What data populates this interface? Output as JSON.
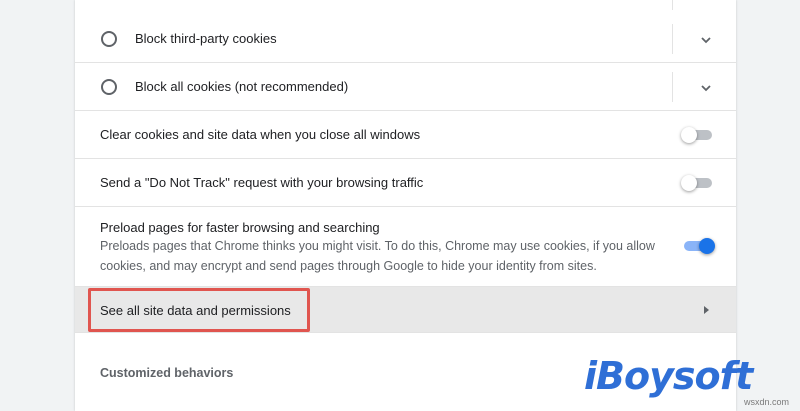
{
  "cookie_options": [
    {
      "label": "Block third-party cookies"
    },
    {
      "label": "Block all cookies (not recommended)"
    }
  ],
  "toggles": {
    "clear_on_close": {
      "label": "Clear cookies and site data when you close all windows",
      "state": "off"
    },
    "do_not_track": {
      "label": "Send a \"Do Not Track\" request with your browsing traffic",
      "state": "off"
    },
    "preload": {
      "label": "Preload pages for faster browsing and searching",
      "description": "Preloads pages that Chrome thinks you might visit. To do this, Chrome may use cookies, if you allow cookies, and may encrypt and send pages through Google to hide your identity from sites.",
      "state": "on"
    }
  },
  "site_data": {
    "label": "See all site data and permissions"
  },
  "customized": {
    "title": "Customized behaviors"
  },
  "watermark": {
    "text": "iBoysoft"
  },
  "site_mark": {
    "text": "wsxdn.com"
  },
  "colors": {
    "accent": "#1a73e8",
    "highlight_box": "#e0554f",
    "watermark": "#2f6fd6"
  },
  "icons": {
    "radio": "radio-unchecked-icon",
    "expand": "chevron-down-icon",
    "navigate": "arrow-right-icon"
  }
}
